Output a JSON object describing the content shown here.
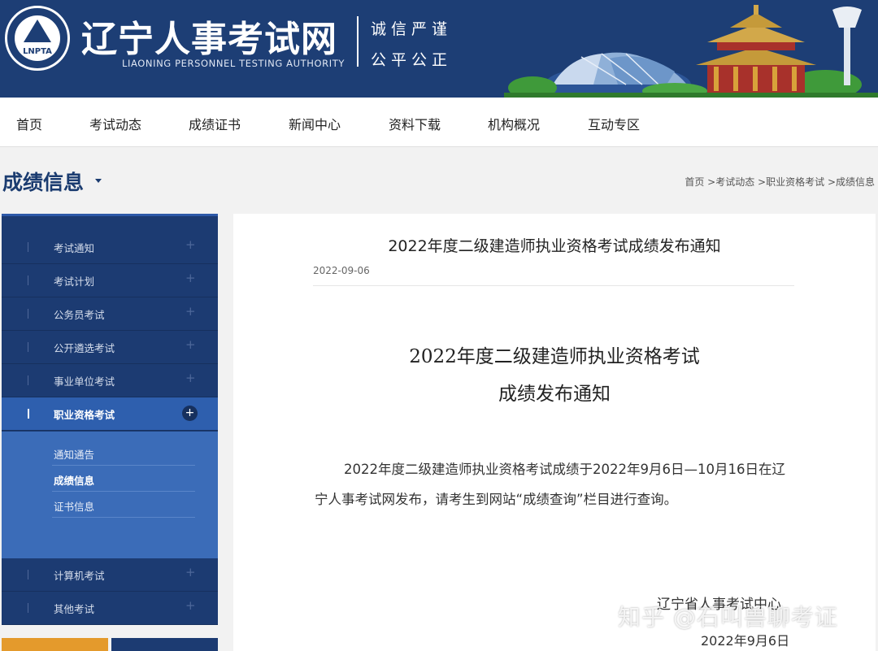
{
  "header": {
    "logo_abbr": "LNPTA",
    "site_title": "辽宁人事考试网",
    "site_subtitle": "LIAONING PERSONNEL TESTING AUTHORITY",
    "motto_line1": "诚信严谨",
    "motto_line2": "公平公正"
  },
  "nav": {
    "items": [
      {
        "label": "首页"
      },
      {
        "label": "考试动态"
      },
      {
        "label": "成绩证书"
      },
      {
        "label": "新闻中心"
      },
      {
        "label": "资料下载"
      },
      {
        "label": "机构概况"
      },
      {
        "label": "互动专区"
      }
    ]
  },
  "section": {
    "title": "成绩信息",
    "breadcrumb": [
      {
        "label": "首页"
      },
      {
        "label": ">考试动态"
      },
      {
        "label": ">职业资格考试"
      },
      {
        "label": ">成绩信息"
      }
    ]
  },
  "sidebar": {
    "items": [
      {
        "label": "考试通知"
      },
      {
        "label": "考试计划"
      },
      {
        "label": "公务员考试"
      },
      {
        "label": "公开遴选考试"
      },
      {
        "label": "事业单位考试"
      },
      {
        "label": "职业资格考试"
      },
      {
        "label": "计算机考试"
      },
      {
        "label": "其他考试"
      }
    ],
    "sub_items": [
      {
        "label": "通知通告"
      },
      {
        "label": "成绩信息"
      },
      {
        "label": "证书信息"
      }
    ]
  },
  "article": {
    "title": "2022年度二级建造师执业资格考试成绩发布通知",
    "date": "2022-09-06",
    "doc_title_line1": "2022年度二级建造师执业资格考试",
    "doc_title_line2": "成绩发布通知",
    "body": "2022年度二级建造师执业资格考试成绩于2022年9月6日—10月16日在辽宁人事考试网发布，请考生到网站“成绩查询”栏目进行查询。",
    "sign_org": "辽宁省人事考试中心",
    "sign_date": "2022年9月6日"
  },
  "watermark": "知乎 @石叫兽聊考证",
  "colors": {
    "brand_navy": "#1d3e75",
    "sidebar_active": "#2e5fae",
    "accent_orange": "#e49a2c"
  }
}
